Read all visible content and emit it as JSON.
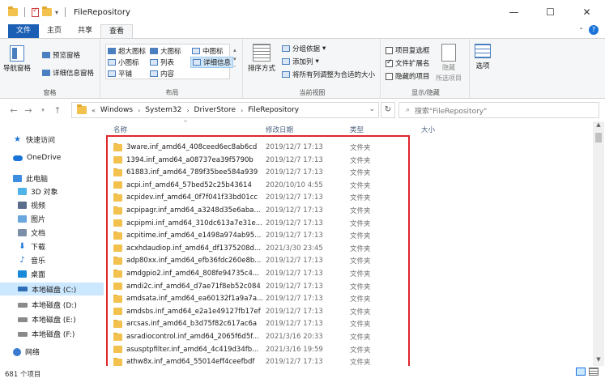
{
  "window": {
    "title": "FileRepository",
    "controls": [
      "—",
      "☐",
      "✕"
    ]
  },
  "ribbon_tabs": [
    {
      "label": "文件"
    },
    {
      "label": "主页"
    },
    {
      "label": "共享"
    },
    {
      "label": "查看"
    }
  ],
  "ribbon": {
    "panes": {
      "nav_pane": "导航窗格",
      "preview_pane": "预览窗格",
      "details_pane": "详细信息窗格",
      "group_label": "窗格"
    },
    "layout": {
      "extra_large": "超大图标",
      "large": "大图标",
      "medium": "中图标",
      "small": "小图标",
      "list": "列表",
      "details": "详细信息",
      "tiles": "平铺",
      "content": "内容",
      "group_label": "布局"
    },
    "current_view": {
      "sort_by": "排序方式",
      "group_by": "分组依据",
      "add_columns": "添加列",
      "size_all_columns": "将所有列调整为合适的大小",
      "group_label": "当前视图"
    },
    "show_hide": {
      "item_checkboxes": "项目复选框",
      "file_name_extensions": "文件扩展名",
      "hidden_items": "隐藏的项目",
      "hide_selected": "隐藏",
      "selected_items": "所选项目",
      "group_label": "显示/隐藏"
    },
    "options": "选项"
  },
  "address": {
    "crumbs": [
      "Windows",
      "System32",
      "DriverStore",
      "FileRepository"
    ],
    "search_placeholder": "搜索\"FileRepository\""
  },
  "nav_pane": {
    "items": [
      {
        "label": "快速访问",
        "icon": "star-icon"
      },
      {
        "label": "OneDrive",
        "icon": "cloud-icon"
      },
      {
        "label": "此电脑",
        "icon": "computer-icon"
      },
      {
        "label": "3D 对象",
        "icon": "3d-objects-icon"
      },
      {
        "label": "视频",
        "icon": "video-icon"
      },
      {
        "label": "图片",
        "icon": "pictures-icon"
      },
      {
        "label": "文档",
        "icon": "documents-icon"
      },
      {
        "label": "下载",
        "icon": "download-icon"
      },
      {
        "label": "音乐",
        "icon": "music-icon"
      },
      {
        "label": "桌面",
        "icon": "desktop-icon"
      },
      {
        "label": "本地磁盘 (C:)",
        "icon": "drive-icon"
      },
      {
        "label": "本地磁盘 (D:)",
        "icon": "drive-icon"
      },
      {
        "label": "本地磁盘 (E:)",
        "icon": "drive-icon"
      },
      {
        "label": "本地磁盘 (F:)",
        "icon": "drive-icon"
      },
      {
        "label": "网络",
        "icon": "network-icon"
      }
    ]
  },
  "columns": {
    "name": "名称",
    "date": "修改日期",
    "type": "类型",
    "size": "大小"
  },
  "files": [
    {
      "name": "3ware.inf_amd64_408ceed6ec8ab6cd",
      "date": "2019/12/7 17:13",
      "type": "文件夹"
    },
    {
      "name": "1394.inf_amd64_a08737ea39f5790b",
      "date": "2019/12/7 17:13",
      "type": "文件夹"
    },
    {
      "name": "61883.inf_amd64_789f35bee584a939",
      "date": "2019/12/7 17:13",
      "type": "文件夹"
    },
    {
      "name": "acpi.inf_amd64_57bed52c25b43614",
      "date": "2020/10/10 4:55",
      "type": "文件夹"
    },
    {
      "name": "acpidev.inf_amd64_0f7f041f33bd01cc",
      "date": "2019/12/7 17:13",
      "type": "文件夹"
    },
    {
      "name": "acpipagr.inf_amd64_a3248d35e6aba...",
      "date": "2019/12/7 17:13",
      "type": "文件夹"
    },
    {
      "name": "acpipmi.inf_amd64_310dc613a7e31e...",
      "date": "2019/12/7 17:13",
      "type": "文件夹"
    },
    {
      "name": "acpitime.inf_amd64_e1498a974ab95...",
      "date": "2019/12/7 17:13",
      "type": "文件夹"
    },
    {
      "name": "acxhdaudiop.inf_amd64_df1375208d...",
      "date": "2021/3/30 23:45",
      "type": "文件夹"
    },
    {
      "name": "adp80xx.inf_amd64_efb36fdc260e8b...",
      "date": "2019/12/7 17:13",
      "type": "文件夹"
    },
    {
      "name": "amdgpio2.inf_amd64_808fe94735c4...",
      "date": "2019/12/7 17:13",
      "type": "文件夹"
    },
    {
      "name": "amdi2c.inf_amd64_d7ae71f8eb52c084",
      "date": "2019/12/7 17:13",
      "type": "文件夹"
    },
    {
      "name": "amdsata.inf_amd64_ea60132f1a9a7a...",
      "date": "2019/12/7 17:13",
      "type": "文件夹"
    },
    {
      "name": "amdsbs.inf_amd64_e2a1e49127fb17ef",
      "date": "2019/12/7 17:13",
      "type": "文件夹"
    },
    {
      "name": "arcsas.inf_amd64_b3d75f82c617ac6a",
      "date": "2019/12/7 17:13",
      "type": "文件夹"
    },
    {
      "name": "asradiocontrol.inf_amd64_2065f6d5f...",
      "date": "2021/3/16 20:33",
      "type": "文件夹"
    },
    {
      "name": "asusptpfilter.inf_amd64_4c419d34fb...",
      "date": "2021/3/16 19:59",
      "type": "文件夹"
    },
    {
      "name": "athw8x.inf_amd64_55014eff4ceefbdf",
      "date": "2019/12/7 17:13",
      "type": "文件夹"
    }
  ],
  "status": {
    "item_count": "681 个项目"
  }
}
